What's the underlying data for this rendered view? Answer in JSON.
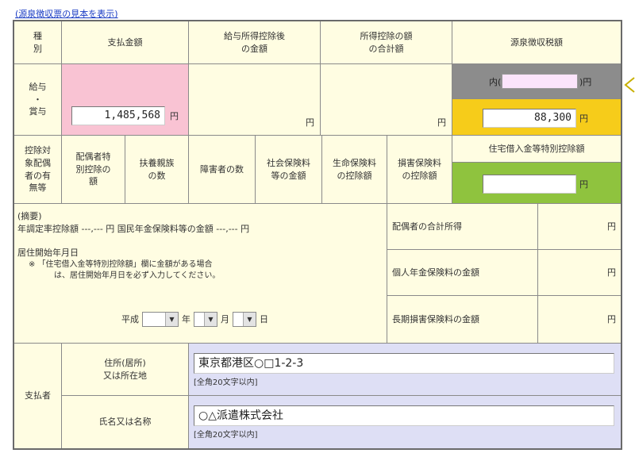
{
  "header": {
    "link_text": "(源泉徴収票の見本を表示)"
  },
  "columns": {
    "kind": [
      "種",
      "別"
    ],
    "payment": "支払金額",
    "after_salary_deduction": [
      "給与所得控除後",
      "の金額"
    ],
    "total_deductions": [
      "所得控除の額",
      "の合計額"
    ],
    "withholding_tax": "源泉徴収税額"
  },
  "income_row": {
    "label": [
      "給与",
      "・",
      "賞与"
    ],
    "payment_value": "1,485,568",
    "yen": "円",
    "inner_label": "内(",
    "inner_close": ")円",
    "inner_value": "",
    "tax_value": "88,300"
  },
  "deduction_headers": {
    "spouse_eligible": [
      "控除対",
      "象配偶",
      "者の有",
      "無等"
    ],
    "spouse_special": [
      "配偶者特",
      "別控除の",
      "額"
    ],
    "dependents": [
      "扶養親族",
      "の数"
    ],
    "disabled": "障害者の数",
    "social_insurance": [
      "社会保険料",
      "等の金額"
    ],
    "life_insurance": [
      "生命保険料",
      "の控除額"
    ],
    "earthquake_insurance": [
      "損害保険料",
      "の控除額"
    ],
    "housing_loan": "住宅借入金等特別控除額"
  },
  "housing_loan_value": "",
  "summary": {
    "title": "(摘要)",
    "line1": "年調定率控除額 ---,--- 円  国民年金保険料等の金額 ---,--- 円",
    "start_label": "居住開始年月日",
    "note1": "※ 「住宅借入金等特別控除額」欄に金額がある場合",
    "note2": "は、居住開始年月日を必ず入力してください。",
    "era": "平成",
    "year_unit": "年",
    "month_unit": "月",
    "day_unit": "日",
    "year_value": "",
    "month_value": "",
    "day_value": ""
  },
  "right_rows": [
    {
      "label": "配偶者の合計所得",
      "yen": "円"
    },
    {
      "label": "個人年金保険料の金額",
      "yen": "円"
    },
    {
      "label": "長期損害保険料の金額",
      "yen": "円"
    }
  ],
  "payer": {
    "label": "支払者",
    "address_label": [
      "住所(居所)",
      "又は所在地"
    ],
    "address_value": "東京都港区○□1-2-3",
    "address_note": "[全角20文字以内]",
    "name_label": "氏名又は名称",
    "name_value": "○△派遣株式会社",
    "name_note": "[全角20文字以内]"
  },
  "colors": {
    "pink": "#f9c3d3",
    "yellow": "#f6cc1a",
    "green": "#8fc33e",
    "gray": "#8c8c8c",
    "lavender": "#dedff5",
    "background": "#fffde2"
  }
}
